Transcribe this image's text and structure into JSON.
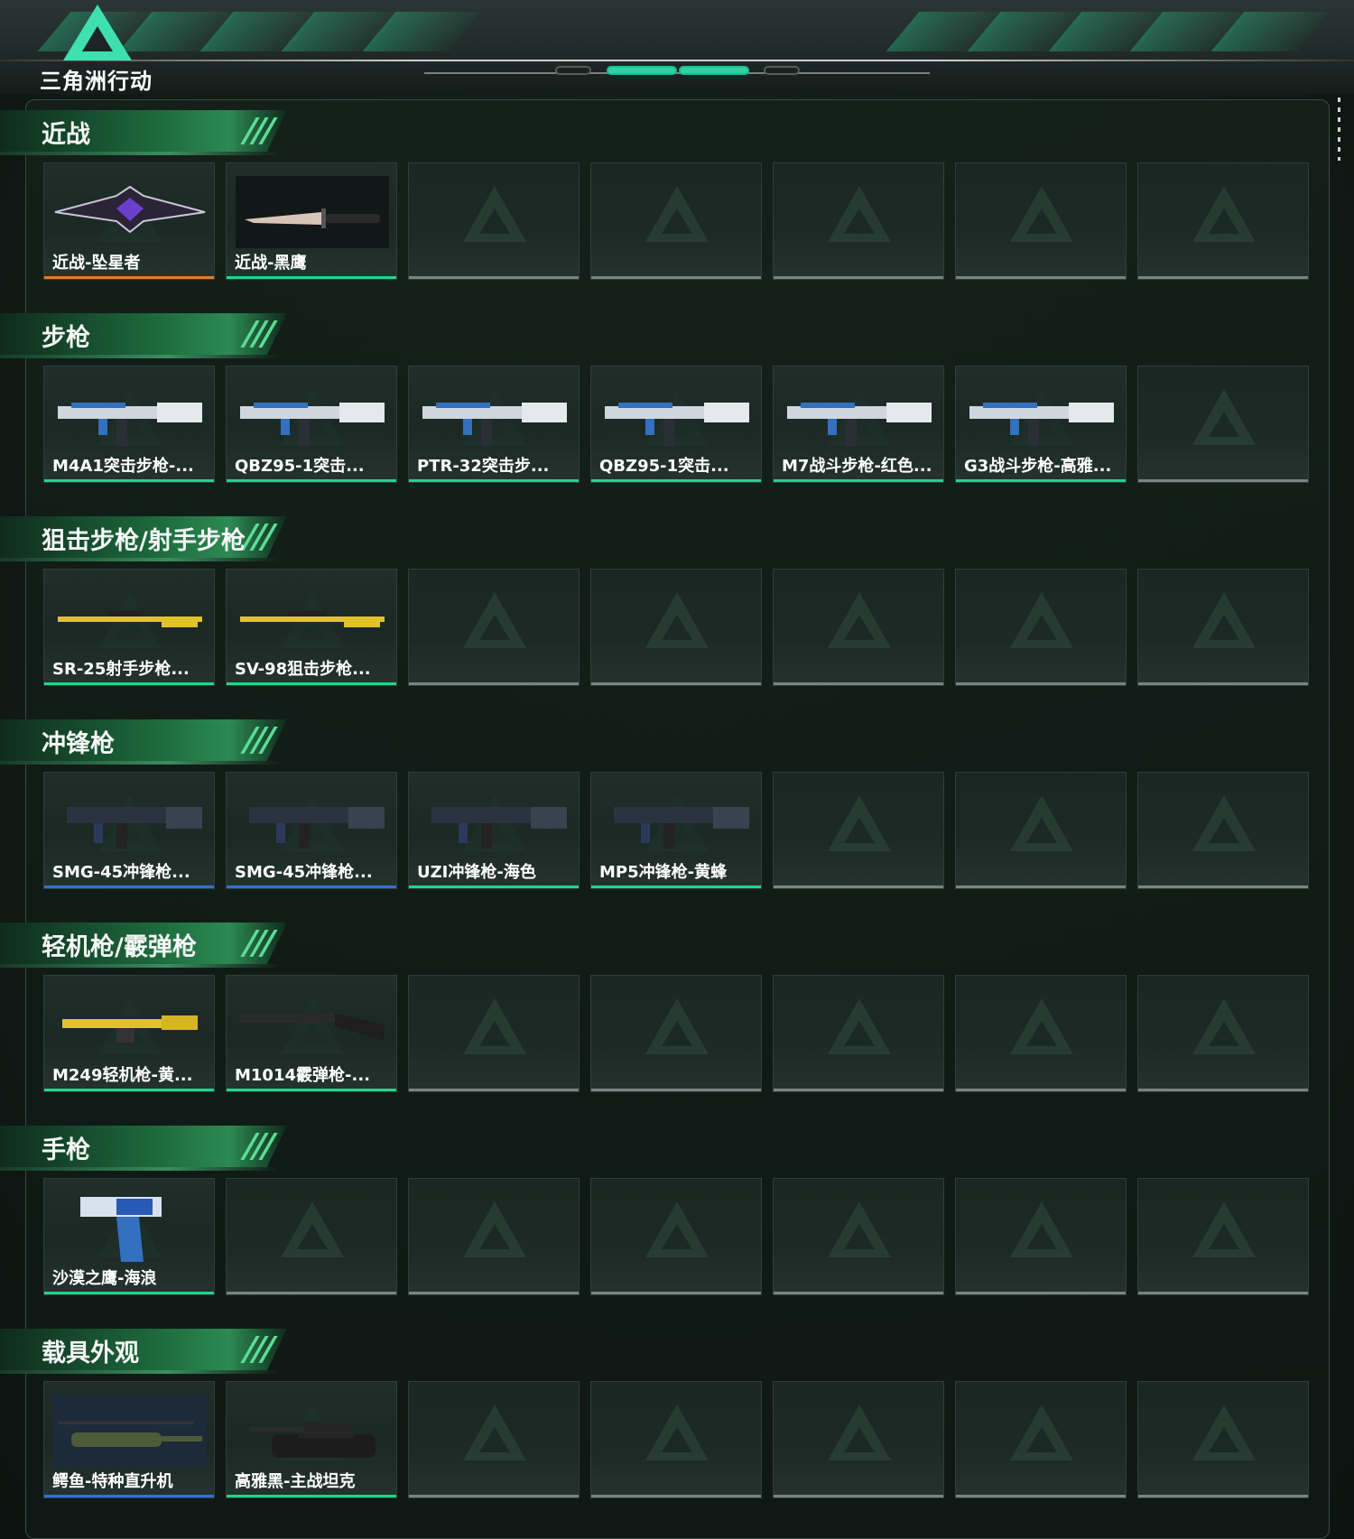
{
  "header": {
    "logo_text": "三角洲行动"
  },
  "colors": {
    "orange": "#e87a2a",
    "green": "#1fd58c",
    "blue": "#2f6fe0",
    "gray": "#7c8380"
  },
  "sections": [
    {
      "title": "近战",
      "cards": [
        {
          "label": "近战-坠星者",
          "bar": "orange",
          "icon": "melee-blade-icon"
        },
        {
          "label": "近战-黑鹰",
          "bar": "green",
          "icon": "knife-icon"
        },
        {
          "empty": true
        },
        {
          "empty": true
        },
        {
          "empty": true
        },
        {
          "empty": true
        },
        {
          "empty": true
        }
      ]
    },
    {
      "title": "步枪",
      "cards": [
        {
          "label": "M4A1突击步枪-...",
          "bar": "green",
          "icon": "rifle-icon"
        },
        {
          "label": "QBZ95-1突击...",
          "bar": "green",
          "icon": "rifle-icon"
        },
        {
          "label": "PTR-32突击步...",
          "bar": "green",
          "icon": "rifle-icon"
        },
        {
          "label": "QBZ95-1突击...",
          "bar": "green",
          "icon": "rifle-icon"
        },
        {
          "label": "M7战斗步枪-红色...",
          "bar": "green",
          "icon": "rifle-icon"
        },
        {
          "label": "G3战斗步枪-高雅...",
          "bar": "green",
          "icon": "rifle-icon"
        },
        {
          "empty": true
        }
      ]
    },
    {
      "title": "狙击步枪/射手步枪",
      "cards": [
        {
          "label": "SR-25射手步枪...",
          "bar": "green",
          "icon": "sniper-rifle-icon"
        },
        {
          "label": "SV-98狙击步枪...",
          "bar": "green",
          "icon": "sniper-rifle-icon"
        },
        {
          "empty": true
        },
        {
          "empty": true
        },
        {
          "empty": true
        },
        {
          "empty": true
        },
        {
          "empty": true
        }
      ]
    },
    {
      "title": "冲锋枪",
      "cards": [
        {
          "label": "SMG-45冲锋枪...",
          "bar": "blue",
          "icon": "smg-icon"
        },
        {
          "label": "SMG-45冲锋枪...",
          "bar": "blue",
          "icon": "smg-icon"
        },
        {
          "label": "UZI冲锋枪-海色",
          "bar": "green",
          "icon": "smg-icon"
        },
        {
          "label": "MP5冲锋枪-黄蜂",
          "bar": "green",
          "icon": "smg-icon"
        },
        {
          "empty": true
        },
        {
          "empty": true
        },
        {
          "empty": true
        }
      ]
    },
    {
      "title": "轻机枪/霰弹枪",
      "cards": [
        {
          "label": "M249轻机枪-黄...",
          "bar": "green",
          "icon": "machine-gun-icon"
        },
        {
          "label": "M1014霰弹枪-...",
          "bar": "green",
          "icon": "shotgun-icon"
        },
        {
          "empty": true
        },
        {
          "empty": true
        },
        {
          "empty": true
        },
        {
          "empty": true
        },
        {
          "empty": true
        }
      ]
    },
    {
      "title": "手枪",
      "cards": [
        {
          "label": "沙漠之鹰-海浪",
          "bar": "green",
          "icon": "pistol-icon"
        },
        {
          "empty": true
        },
        {
          "empty": true
        },
        {
          "empty": true
        },
        {
          "empty": true
        },
        {
          "empty": true
        },
        {
          "empty": true
        }
      ]
    },
    {
      "title": "载具外观",
      "cards": [
        {
          "label": "鳄鱼-特种直升机",
          "bar": "blue",
          "icon": "helicopter-icon"
        },
        {
          "label": "高雅黑-主战坦克",
          "bar": "green",
          "icon": "tank-icon"
        },
        {
          "empty": true
        },
        {
          "empty": true
        },
        {
          "empty": true
        },
        {
          "empty": true
        },
        {
          "empty": true
        }
      ]
    }
  ]
}
